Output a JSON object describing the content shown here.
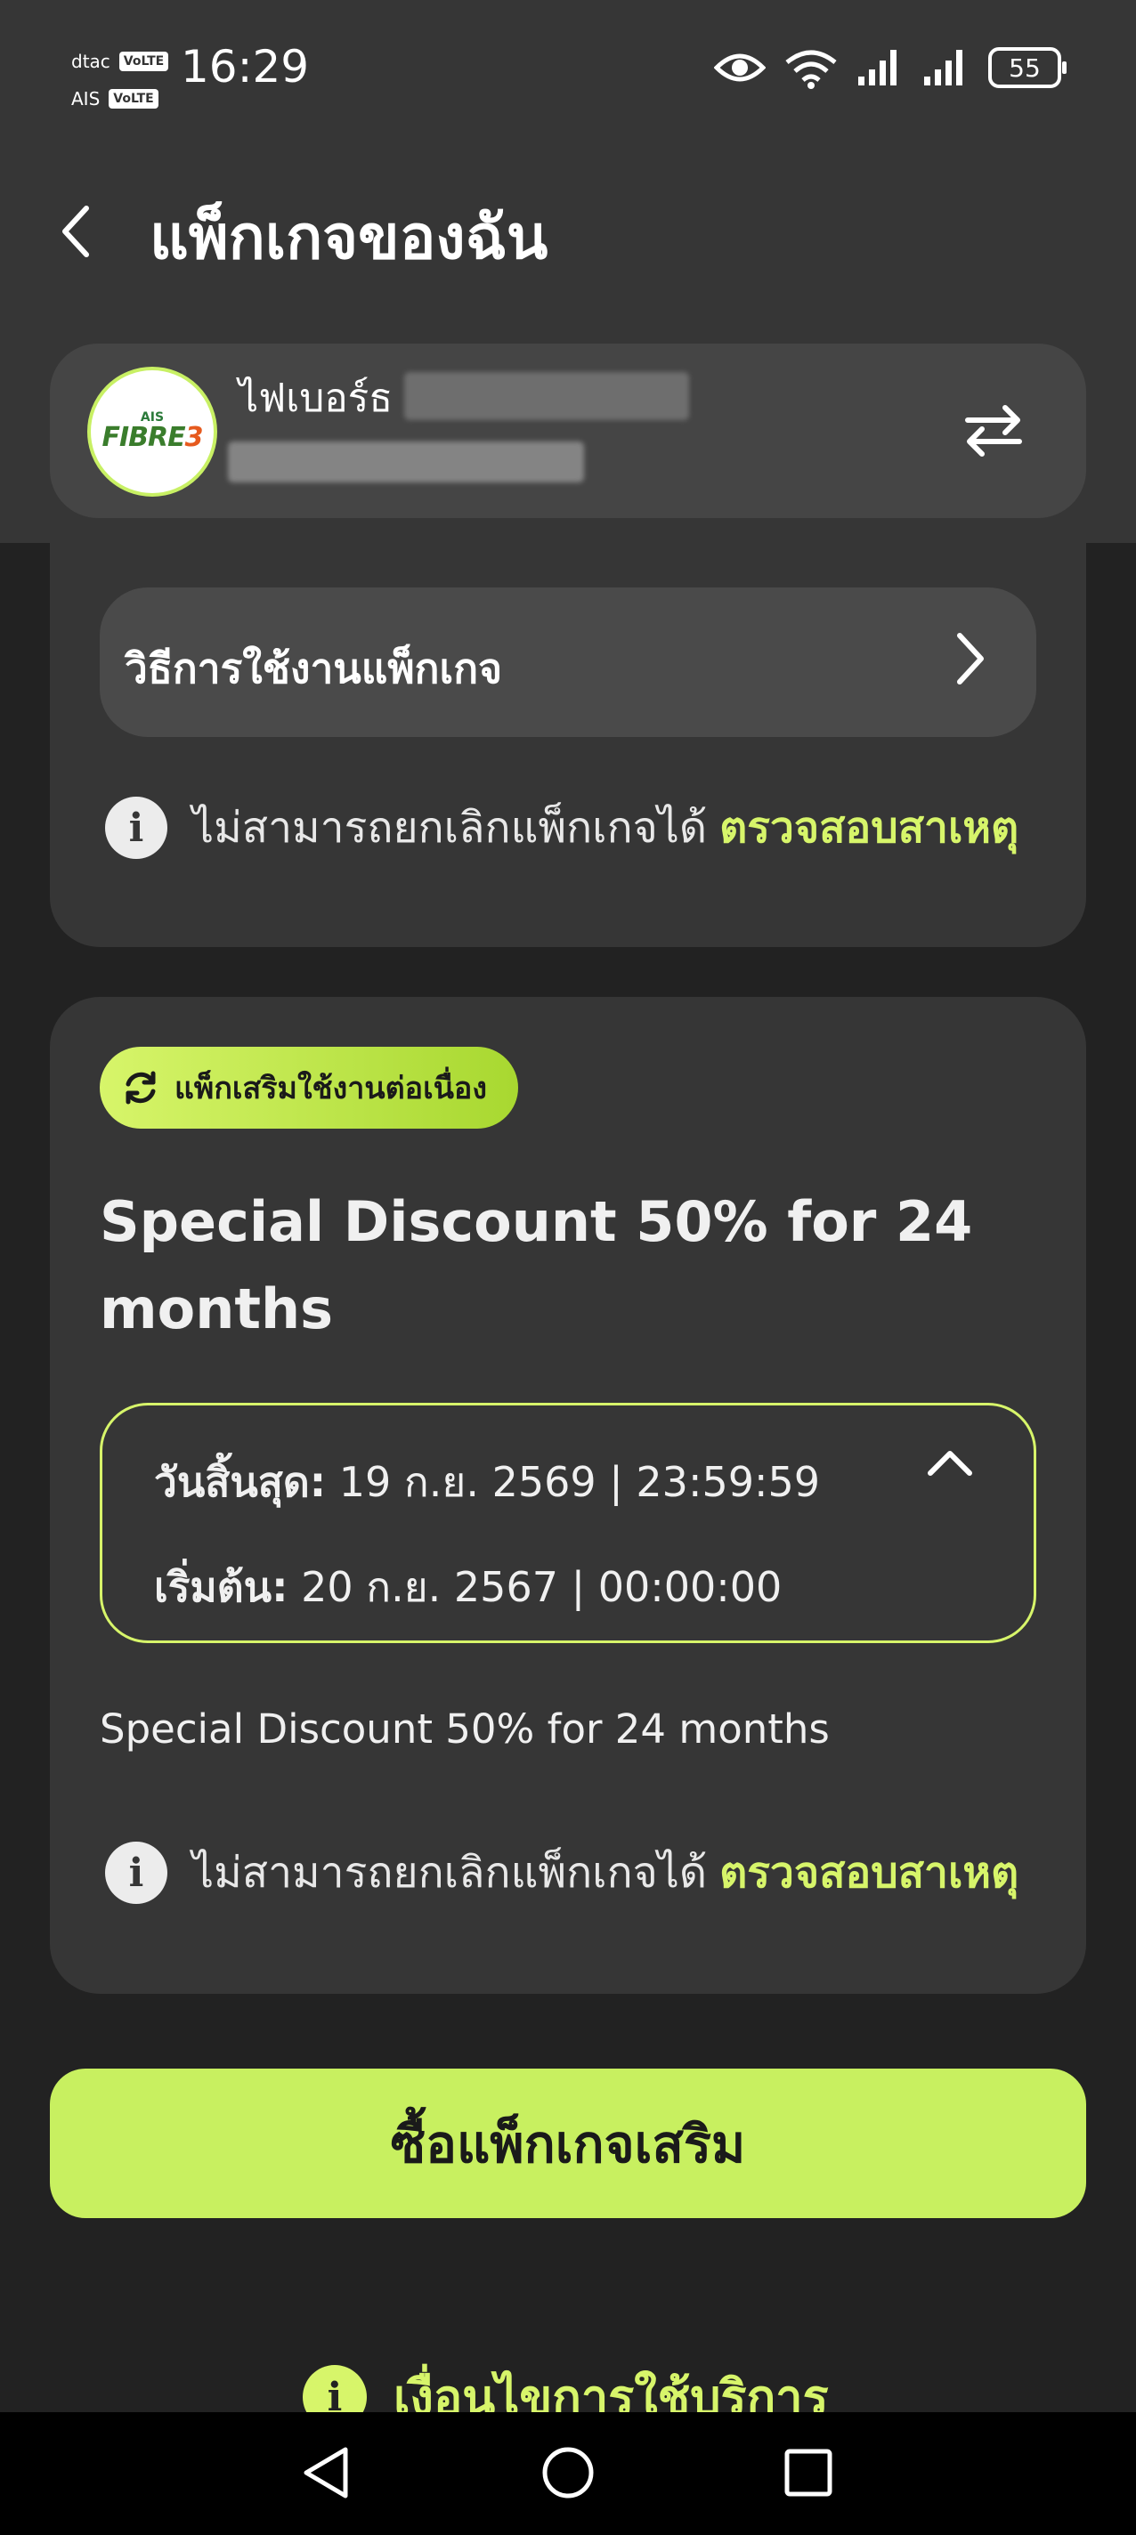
{
  "status_bar": {
    "carrier_1": "dtac",
    "carrier_2": "AIS",
    "volte_label": "VoLTE",
    "time": "16:29",
    "battery": "55"
  },
  "header": {
    "title": "แพ็กเกจของฉัน",
    "account": {
      "logo_small": "AIS",
      "logo_main_left": "FIBRE",
      "logo_main_right": "3",
      "name_prefix": "ไฟเบอร์ธ"
    }
  },
  "usage_card": {
    "howto_label": "วิธีการใช้งานแพ็กเกจ",
    "cannot_cancel": "ไม่สามารถยกเลิกแพ็กเกจได้",
    "check_reason": "ตรวจสอบสาเหตุ"
  },
  "package_card": {
    "badge": "แพ็กเสริมใช้งานต่อเนื่อง",
    "title": "Special Discount 50% for 24 months",
    "end_label": "วันสิ้นสุด:",
    "end_value": "19 ก.ย. 2569 | 23:59:59",
    "start_label": "เริ่มต้น:",
    "start_value": "20 ก.ย. 2567 | 00:00:00",
    "description": "Special Discount 50% for 24 months",
    "cannot_cancel": "ไม่สามารถยกเลิกแพ็กเกจได้",
    "check_reason": "ตรวจสอบสาเหตุ"
  },
  "buy_button": "ซื้อแพ็กเกจเสริม",
  "terms_label": "เงื่อนไขการใช้บริการ",
  "colors": {
    "accent": "#c8f060",
    "background": "#222222",
    "card": "#363636",
    "link": "#d7f56a"
  }
}
